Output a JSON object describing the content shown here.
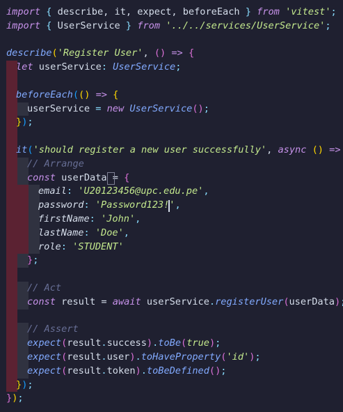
{
  "editor": {
    "colors": {
      "background": "#1f2030",
      "keyword": "#c792ea",
      "function": "#82aaff",
      "string": "#c3e88d",
      "comment": "#676e95",
      "indent_error": "#5b2232",
      "indent_guide": "#303240"
    },
    "lines": [
      {
        "tokens": [
          {
            "t": "import",
            "c": "kw"
          },
          {
            "t": " ",
            "c": "var"
          },
          {
            "t": "{",
            "c": "pun"
          },
          {
            "t": " describe, it, expect, beforeEach ",
            "c": "var"
          },
          {
            "t": "}",
            "c": "pun"
          },
          {
            "t": " ",
            "c": "var"
          },
          {
            "t": "from",
            "c": "kw"
          },
          {
            "t": " ",
            "c": "var"
          },
          {
            "t": "'vitest'",
            "c": "str"
          },
          {
            "t": ";",
            "c": "pun"
          }
        ]
      },
      {
        "tokens": [
          {
            "t": "import",
            "c": "kw"
          },
          {
            "t": " ",
            "c": "var"
          },
          {
            "t": "{",
            "c": "pun"
          },
          {
            "t": " UserService ",
            "c": "var"
          },
          {
            "t": "}",
            "c": "pun"
          },
          {
            "t": " ",
            "c": "var"
          },
          {
            "t": "from",
            "c": "kw"
          },
          {
            "t": " ",
            "c": "var"
          },
          {
            "t": "'../../services/UserService'",
            "c": "str"
          },
          {
            "t": ";",
            "c": "pun"
          }
        ]
      },
      {
        "tokens": []
      },
      {
        "tokens": [
          {
            "t": "describe",
            "c": "fn"
          },
          {
            "t": "(",
            "c": "brk1"
          },
          {
            "t": "'Register User'",
            "c": "str"
          },
          {
            "t": ", ",
            "c": "var"
          },
          {
            "t": "()",
            "c": "brk2"
          },
          {
            "t": " ",
            "c": "var"
          },
          {
            "t": "=>",
            "c": "kw"
          },
          {
            "t": " ",
            "c": "var"
          },
          {
            "t": "{",
            "c": "brk2"
          }
        ]
      },
      {
        "indent": [
          "red"
        ],
        "tokens": [
          {
            "t": "let",
            "c": "kw"
          },
          {
            "t": " userService",
            "c": "var"
          },
          {
            "t": ": ",
            "c": "pun"
          },
          {
            "t": "UserService",
            "c": "fn"
          },
          {
            "t": ";",
            "c": "pun"
          }
        ]
      },
      {
        "indent": [
          "red"
        ],
        "tokens": []
      },
      {
        "indent": [
          "red"
        ],
        "tokens": [
          {
            "t": "beforeEach",
            "c": "fn"
          },
          {
            "t": "(",
            "c": "brk3"
          },
          {
            "t": "()",
            "c": "brk1"
          },
          {
            "t": " ",
            "c": "var"
          },
          {
            "t": "=>",
            "c": "kw"
          },
          {
            "t": " ",
            "c": "var"
          },
          {
            "t": "{",
            "c": "brk1"
          }
        ]
      },
      {
        "indent": [
          "red",
          "grey"
        ],
        "tokens": [
          {
            "t": "userService",
            "c": "var"
          },
          {
            "t": " = ",
            "c": "pun"
          },
          {
            "t": "new",
            "c": "kw"
          },
          {
            "t": " ",
            "c": "var"
          },
          {
            "t": "UserService",
            "c": "fn"
          },
          {
            "t": "()",
            "c": "brk2"
          },
          {
            "t": ";",
            "c": "pun"
          }
        ]
      },
      {
        "indent": [
          "red"
        ],
        "tokens": [
          {
            "t": "}",
            "c": "brk1"
          },
          {
            "t": ")",
            "c": "brk3"
          },
          {
            "t": ";",
            "c": "pun"
          }
        ]
      },
      {
        "indent": [
          "red"
        ],
        "tokens": []
      },
      {
        "indent": [
          "red"
        ],
        "tokens": [
          {
            "t": "it",
            "c": "fn"
          },
          {
            "t": "(",
            "c": "brk3"
          },
          {
            "t": "'should register a new user successfully'",
            "c": "str"
          },
          {
            "t": ", ",
            "c": "var"
          },
          {
            "t": "async",
            "c": "kw"
          },
          {
            "t": " ",
            "c": "var"
          },
          {
            "t": "()",
            "c": "brk1"
          },
          {
            "t": " ",
            "c": "var"
          },
          {
            "t": "=>",
            "c": "kw"
          },
          {
            "t": " ",
            "c": "var"
          },
          {
            "t": "{",
            "c": "brk1"
          }
        ]
      },
      {
        "indent": [
          "red",
          "grey"
        ],
        "tokens": [
          {
            "t": "// Arrange",
            "c": "com"
          }
        ]
      },
      {
        "indent": [
          "red",
          "grey"
        ],
        "tokens": [
          {
            "t": "const",
            "c": "kw"
          },
          {
            "t": " userData = ",
            "c": "var"
          },
          {
            "t": "{",
            "c": "brk2"
          }
        ]
      },
      {
        "indent": [
          "red",
          "red",
          "grey"
        ],
        "tokens": [
          {
            "t": "email",
            "c": "keyp"
          },
          {
            "t": ": ",
            "c": "pun"
          },
          {
            "t": "'U20123456@upc.edu.pe'",
            "c": "str"
          },
          {
            "t": ",",
            "c": "pun"
          }
        ]
      },
      {
        "indent": [
          "red",
          "red",
          "grey"
        ],
        "tokens": [
          {
            "t": "password",
            "c": "keyp"
          },
          {
            "t": ": ",
            "c": "pun"
          },
          {
            "t": "'Password123!'",
            "c": "str"
          },
          {
            "t": ",",
            "c": "pun"
          }
        ]
      },
      {
        "indent": [
          "red",
          "red",
          "grey"
        ],
        "tokens": [
          {
            "t": "firstName",
            "c": "keyp"
          },
          {
            "t": ": ",
            "c": "pun"
          },
          {
            "t": "'John'",
            "c": "str"
          },
          {
            "t": ",",
            "c": "pun"
          }
        ]
      },
      {
        "indent": [
          "red",
          "red",
          "grey"
        ],
        "tokens": [
          {
            "t": "lastName",
            "c": "keyp"
          },
          {
            "t": ": ",
            "c": "pun"
          },
          {
            "t": "'Doe'",
            "c": "str"
          },
          {
            "t": ",",
            "c": "pun"
          }
        ]
      },
      {
        "indent": [
          "red",
          "red",
          "grey"
        ],
        "tokens": [
          {
            "t": "role",
            "c": "keyp"
          },
          {
            "t": ": ",
            "c": "pun"
          },
          {
            "t": "'STUDENT'",
            "c": "str"
          }
        ]
      },
      {
        "indent": [
          "red",
          "grey"
        ],
        "tokens": [
          {
            "t": "}",
            "c": "brk2"
          },
          {
            "t": ";",
            "c": "pun"
          }
        ]
      },
      {
        "indent": [
          "red"
        ],
        "tokens": []
      },
      {
        "indent": [
          "red",
          "grey"
        ],
        "tokens": [
          {
            "t": "// Act",
            "c": "com"
          }
        ]
      },
      {
        "indent": [
          "red",
          "grey"
        ],
        "tokens": [
          {
            "t": "const",
            "c": "kw"
          },
          {
            "t": " result = ",
            "c": "var"
          },
          {
            "t": "await",
            "c": "kw"
          },
          {
            "t": " userService",
            "c": "var"
          },
          {
            "t": ".",
            "c": "pun"
          },
          {
            "t": "registerUser",
            "c": "fn"
          },
          {
            "t": "(",
            "c": "brk2"
          },
          {
            "t": "userData",
            "c": "var"
          },
          {
            "t": ")",
            "c": "brk2"
          },
          {
            "t": ";",
            "c": "pun"
          }
        ]
      },
      {
        "indent": [
          "red"
        ],
        "tokens": []
      },
      {
        "indent": [
          "red",
          "grey"
        ],
        "tokens": [
          {
            "t": "// Assert",
            "c": "com"
          }
        ]
      },
      {
        "indent": [
          "red",
          "grey"
        ],
        "tokens": [
          {
            "t": "expect",
            "c": "fn"
          },
          {
            "t": "(",
            "c": "brk2"
          },
          {
            "t": "result",
            "c": "var"
          },
          {
            "t": ".",
            "c": "pun"
          },
          {
            "t": "success",
            "c": "var"
          },
          {
            "t": ")",
            "c": "brk2"
          },
          {
            "t": ".",
            "c": "pun"
          },
          {
            "t": "toBe",
            "c": "fn"
          },
          {
            "t": "(",
            "c": "brk2"
          },
          {
            "t": "true",
            "c": "str"
          },
          {
            "t": ")",
            "c": "brk2"
          },
          {
            "t": ";",
            "c": "pun"
          }
        ]
      },
      {
        "indent": [
          "red",
          "grey"
        ],
        "tokens": [
          {
            "t": "expect",
            "c": "fn"
          },
          {
            "t": "(",
            "c": "brk2"
          },
          {
            "t": "result",
            "c": "var"
          },
          {
            "t": ".",
            "c": "pun"
          },
          {
            "t": "user",
            "c": "var"
          },
          {
            "t": ")",
            "c": "brk2"
          },
          {
            "t": ".",
            "c": "pun"
          },
          {
            "t": "toHaveProperty",
            "c": "fn"
          },
          {
            "t": "(",
            "c": "brk2"
          },
          {
            "t": "'id'",
            "c": "str"
          },
          {
            "t": ")",
            "c": "brk2"
          },
          {
            "t": ";",
            "c": "pun"
          }
        ]
      },
      {
        "indent": [
          "red",
          "grey"
        ],
        "tokens": [
          {
            "t": "expect",
            "c": "fn"
          },
          {
            "t": "(",
            "c": "brk2"
          },
          {
            "t": "result",
            "c": "var"
          },
          {
            "t": ".",
            "c": "pun"
          },
          {
            "t": "token",
            "c": "var"
          },
          {
            "t": ")",
            "c": "brk2"
          },
          {
            "t": ".",
            "c": "pun"
          },
          {
            "t": "toBeDefined",
            "c": "fn"
          },
          {
            "t": "()",
            "c": "brk2"
          },
          {
            "t": ";",
            "c": "pun"
          }
        ]
      },
      {
        "indent": [
          "red"
        ],
        "tokens": [
          {
            "t": "}",
            "c": "brk1"
          },
          {
            "t": ")",
            "c": "brk3"
          },
          {
            "t": ";",
            "c": "pun"
          }
        ]
      },
      {
        "tokens": [
          {
            "t": "}",
            "c": "brk2"
          },
          {
            "t": ")",
            "c": "brk1"
          },
          {
            "t": ";",
            "c": "pun"
          }
        ]
      }
    ]
  }
}
